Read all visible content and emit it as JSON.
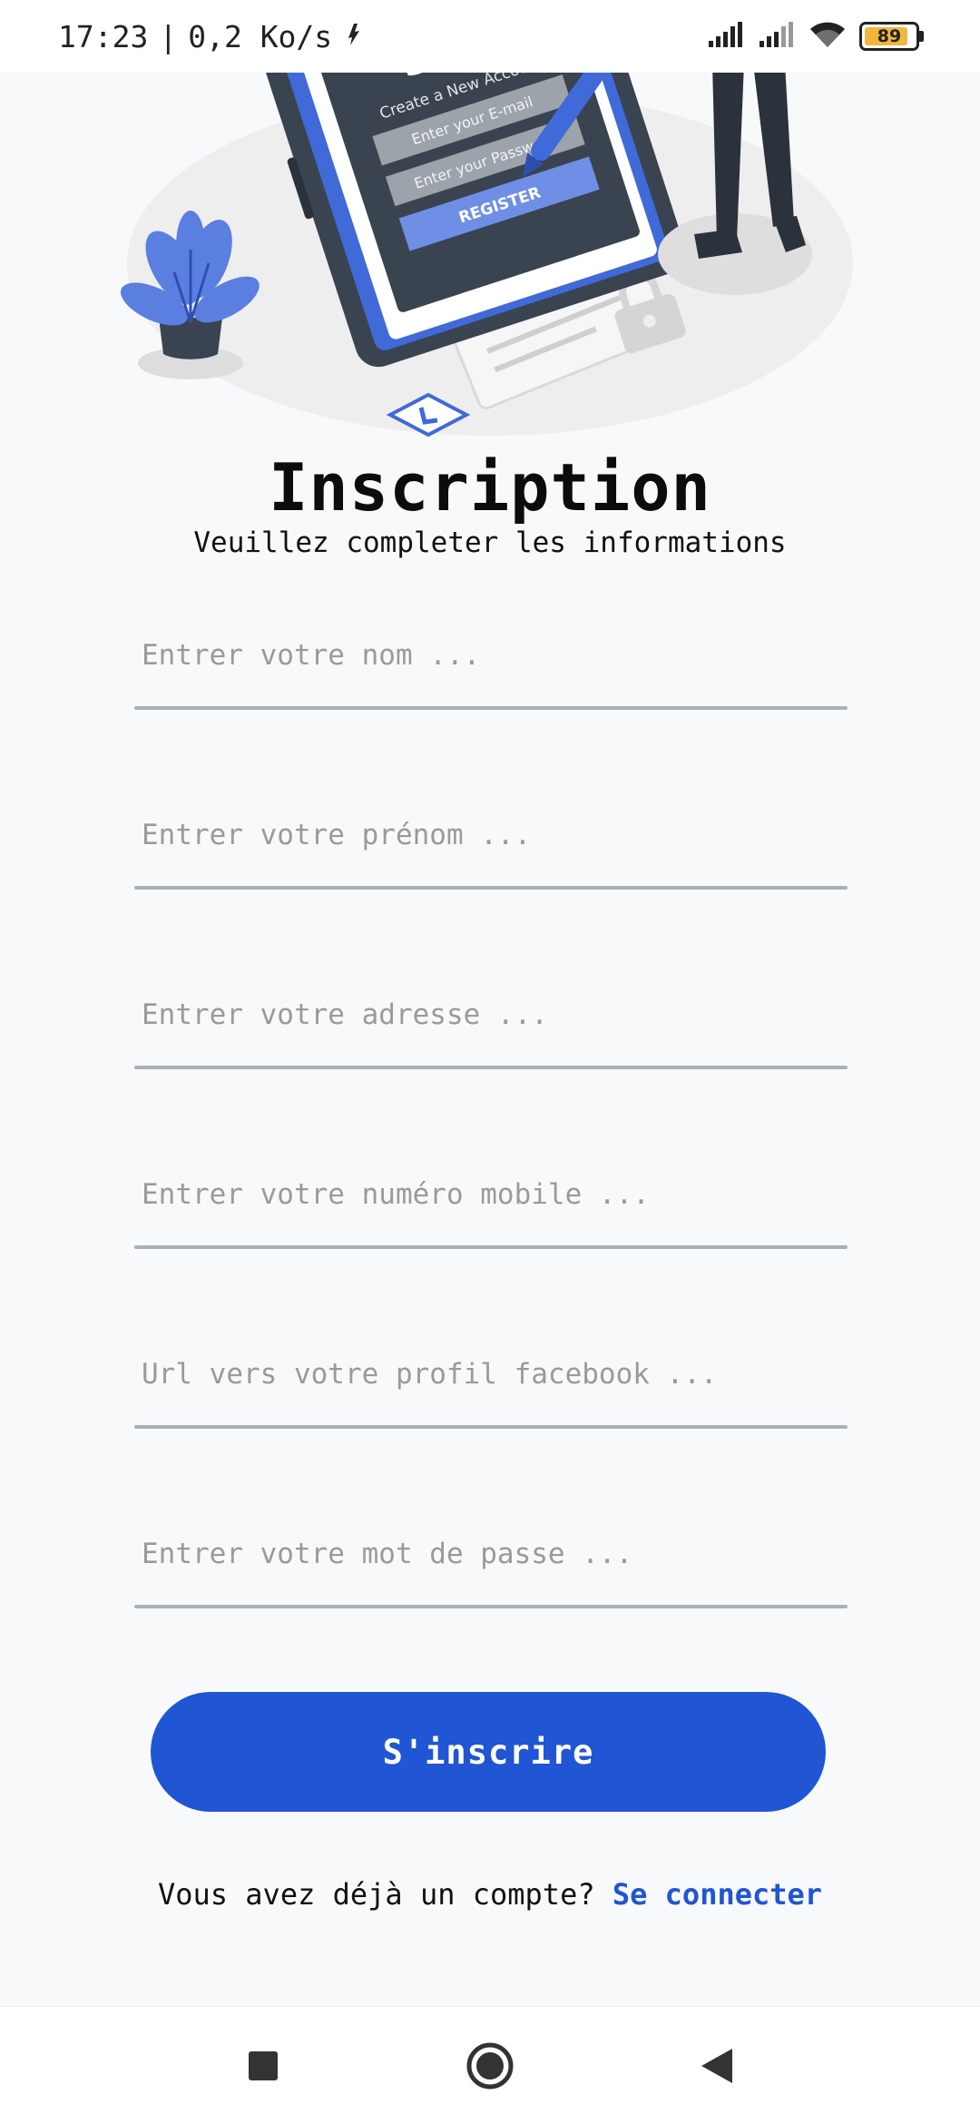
{
  "status_bar": {
    "time": "17:23",
    "separator": "|",
    "speed": "0,2 Ko/s",
    "battery_level": "89",
    "icons": [
      "notification-icon",
      "signal-icon",
      "signal-icon-2",
      "wifi-icon",
      "battery-icon"
    ]
  },
  "colors": {
    "accent": "#2055d4",
    "background": "#f8f9fb",
    "underline": "#a9b0b8",
    "battery_fill": "#f2b63c"
  },
  "hero": {
    "mock_screen_title": "SIGN",
    "mock_screen_subtitle": "Create a New Account",
    "mock_email_placeholder": "Enter your E-mail",
    "mock_password_placeholder": "Enter your Password",
    "mock_register_label": "REGISTER"
  },
  "header": {
    "title": "Inscription",
    "subtitle": "Veuillez completer les informations"
  },
  "form": {
    "fields": [
      {
        "placeholder": "Entrer votre nom ...",
        "value": ""
      },
      {
        "placeholder": "Entrer votre prénom ...",
        "value": ""
      },
      {
        "placeholder": "Entrer votre adresse ...",
        "value": ""
      },
      {
        "placeholder": "Entrer votre numéro mobile ...",
        "value": ""
      },
      {
        "placeholder": "Url vers votre profil facebook ...",
        "value": ""
      },
      {
        "placeholder": "Entrer votre mot de passe ...",
        "value": ""
      }
    ],
    "submit_label": "S'inscrire"
  },
  "footer": {
    "question": "Vous avez déjà un compte?",
    "login_link": "Se connecter"
  },
  "nav": {
    "icons": [
      "recent-apps-icon",
      "home-icon",
      "back-icon"
    ]
  }
}
